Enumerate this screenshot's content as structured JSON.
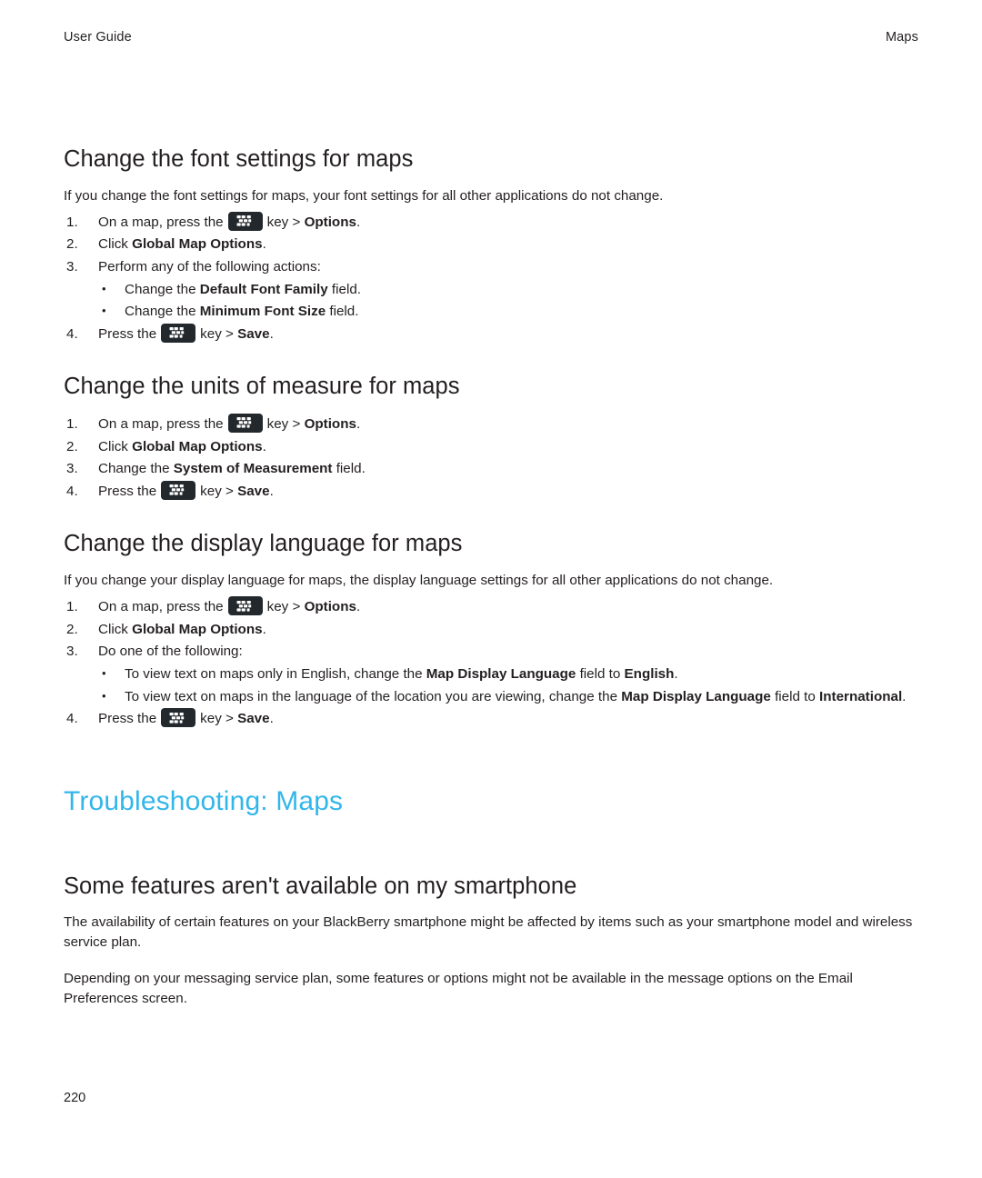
{
  "header": {
    "left": "User Guide",
    "right": "Maps"
  },
  "colors": {
    "chapter_heading": "#33b6ea",
    "text": "#231f20",
    "key_background": "#23282d"
  },
  "icons": {
    "menu_key": "blackberry-menu-key-icon"
  },
  "sections": [
    {
      "heading": "Change the font settings for maps",
      "intro": "If you change the font settings for maps, your font settings for all other applications do not change.",
      "steps": [
        {
          "num": "1.",
          "pre": "On a map, press the",
          "key": true,
          "mid": "key > ",
          "bold": "Options",
          "post": "."
        },
        {
          "num": "2.",
          "pre": "Click ",
          "key": false,
          "bold": "Global Map Options",
          "post": "."
        },
        {
          "num": "3.",
          "pre": "Perform any of the following actions:",
          "key": false,
          "bullets": [
            {
              "pre": "Change the ",
              "bold": "Default Font Family",
              "post": " field."
            },
            {
              "pre": "Change the ",
              "bold": "Minimum Font Size",
              "post": " field."
            }
          ]
        },
        {
          "num": "4.",
          "pre": "Press the",
          "key": true,
          "mid": "key > ",
          "bold": "Save",
          "post": "."
        }
      ]
    },
    {
      "heading": "Change the units of measure for maps",
      "intro": "",
      "steps": [
        {
          "num": "1.",
          "pre": "On a map, press the",
          "key": true,
          "mid": "key > ",
          "bold": "Options",
          "post": "."
        },
        {
          "num": "2.",
          "pre": "Click ",
          "key": false,
          "bold": "Global Map Options",
          "post": "."
        },
        {
          "num": "3.",
          "pre": "Change the ",
          "key": false,
          "bold": "System of Measurement",
          "post": " field."
        },
        {
          "num": "4.",
          "pre": "Press the",
          "key": true,
          "mid": "key > ",
          "bold": "Save",
          "post": "."
        }
      ]
    },
    {
      "heading": "Change the display language for maps",
      "intro": "If you change your display language for maps, the display language settings for all other applications do not change.",
      "steps": [
        {
          "num": "1.",
          "pre": "On a map, press the",
          "key": true,
          "mid": "key > ",
          "bold": "Options",
          "post": "."
        },
        {
          "num": "2.",
          "pre": "Click ",
          "key": false,
          "bold": "Global Map Options",
          "post": "."
        },
        {
          "num": "3.",
          "pre": "Do one of the following:",
          "key": false,
          "bullets": [
            {
              "pre": "To view text on maps only in English, change the ",
              "bold": "Map Display Language",
              "mid": " field to ",
              "bold2": "English",
              "post": "."
            },
            {
              "pre": "To view text on maps in the language of the location you are viewing, change the ",
              "bold": "Map Display Language",
              "mid": " field to ",
              "bold2": "International",
              "post": "."
            }
          ]
        },
        {
          "num": "4.",
          "pre": "Press the",
          "key": true,
          "mid": "key > ",
          "bold": "Save",
          "post": "."
        }
      ]
    }
  ],
  "chapter": {
    "heading": "Troubleshooting: Maps"
  },
  "troubleshooting": {
    "heading": "Some features aren't available on my smartphone",
    "paragraphs": [
      "The availability of certain features on your BlackBerry smartphone might be affected by items such as your smartphone model and wireless service plan.",
      "Depending on your messaging service plan, some features or options might not be available in the message options on the Email Preferences screen."
    ]
  },
  "footer": {
    "page_number": "220"
  }
}
